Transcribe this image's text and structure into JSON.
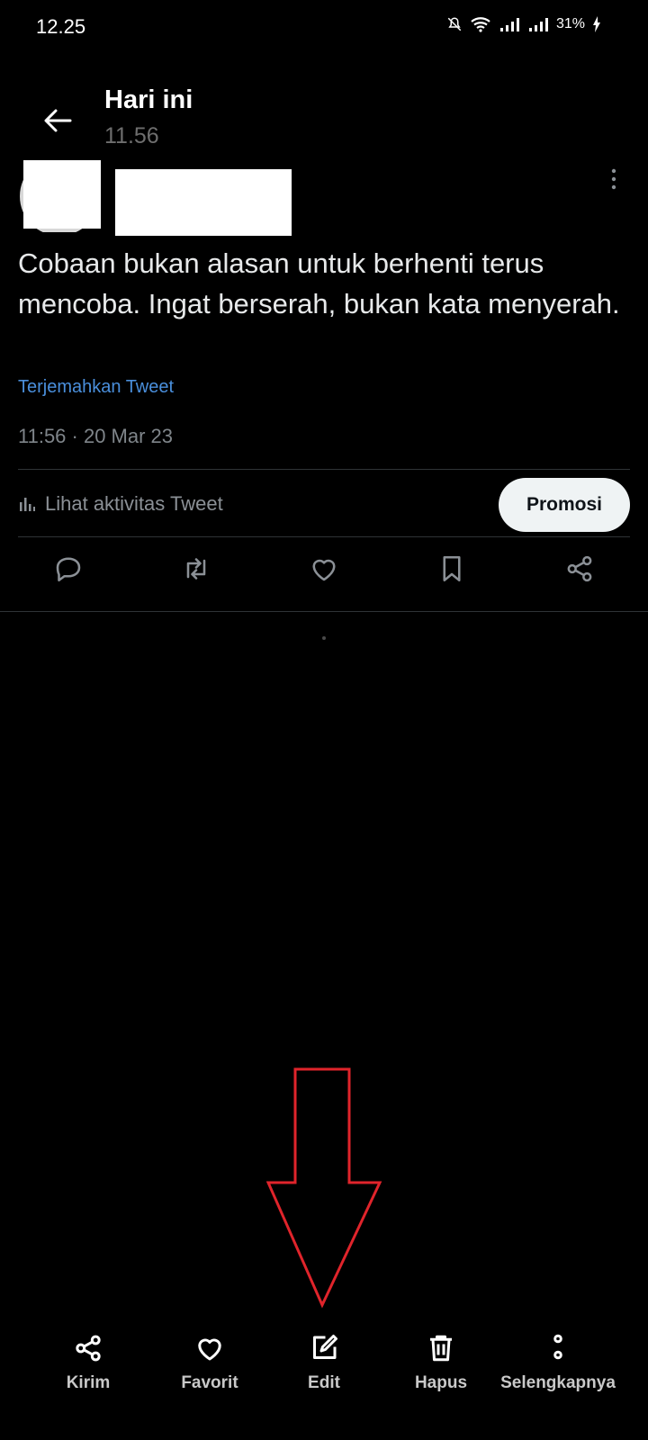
{
  "status_bar": {
    "time": "12.25",
    "battery": "31%"
  },
  "header": {
    "title": "Hari ini",
    "subtitle": "11.56"
  },
  "tweet": {
    "text": "Cobaan bukan alasan untuk berhenti terus mencoba. Ingat berserah, bukan kata menyerah.",
    "translate_label": "Terjemahkan Tweet",
    "timestamp": "11:56 · 20 Mar 23",
    "activity_label": "Lihat aktivitas Tweet",
    "promote_label": "Promosi"
  },
  "actions": [
    "reply-icon",
    "retweet-icon",
    "like-icon",
    "bookmark-icon",
    "share-icon"
  ],
  "bottom_bar": {
    "send": "Kirim",
    "favorite": "Favorit",
    "edit": "Edit",
    "delete": "Hapus",
    "more": "Selengkapnya"
  },
  "colors": {
    "accent_link": "#4a8fdc",
    "annotation_arrow": "#e0242b",
    "promote_bg": "#eff3f4"
  }
}
